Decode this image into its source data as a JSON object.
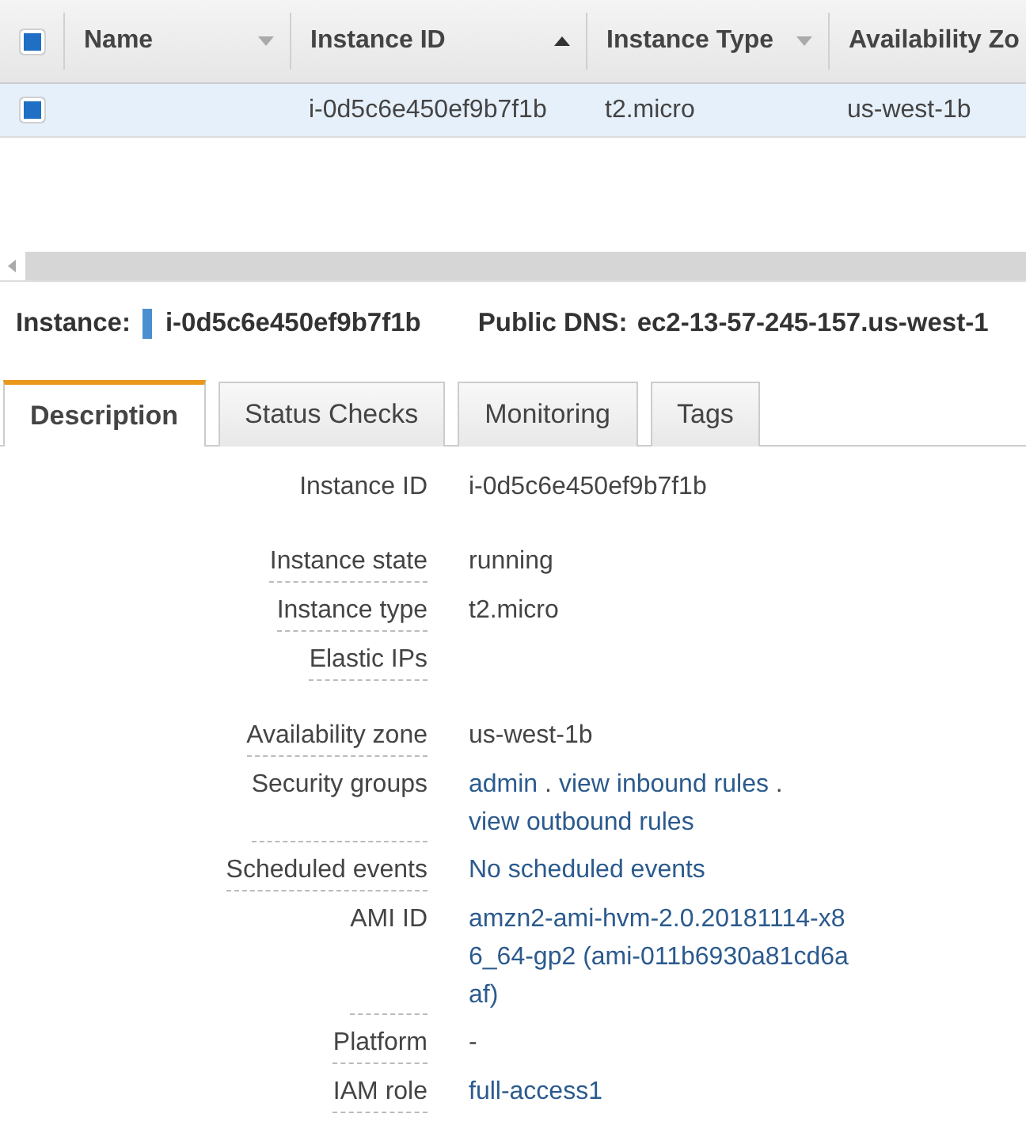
{
  "table": {
    "select_all": {
      "checked": true
    },
    "columns": [
      {
        "label": "Name",
        "sorted": false
      },
      {
        "label": "Instance ID",
        "sorted": true
      },
      {
        "label": "Instance Type",
        "sorted": false
      },
      {
        "label": "Availability Zo"
      }
    ],
    "rows": [
      {
        "selected": true,
        "checked": true,
        "cells": [
          "",
          "i-0d5c6e450ef9b7f1b",
          "t2.micro",
          "us-west-1b"
        ]
      }
    ]
  },
  "summary": {
    "instance_label": "Instance:",
    "instance_id": "i-0d5c6e450ef9b7f1b",
    "dns_label": "Public DNS:",
    "dns": "ec2-13-57-245-157.us-west-1"
  },
  "tabs": [
    {
      "label": "Description",
      "selected": true
    },
    {
      "label": "Status Checks",
      "selected": false
    },
    {
      "label": "Monitoring",
      "selected": false
    },
    {
      "label": "Tags",
      "selected": false
    }
  ],
  "sections": [
    [
      {
        "label": "Instance ID",
        "dashed": false,
        "parts": [
          {
            "kind": "text",
            "text": "i-0d5c6e450ef9b7f1b"
          }
        ]
      }
    ],
    [
      {
        "label": "Instance state",
        "dashed": true,
        "parts": [
          {
            "kind": "text",
            "text": "running"
          }
        ]
      },
      {
        "label": "Instance type",
        "dashed": true,
        "parts": [
          {
            "kind": "text",
            "text": "t2.micro"
          }
        ]
      },
      {
        "label": "Elastic IPs",
        "dashed": true
      }
    ],
    [
      {
        "label": "Availability zone",
        "dashed": true,
        "parts": [
          {
            "kind": "text",
            "text": "us-west-1b"
          }
        ]
      },
      {
        "label": "Security groups",
        "dashed": true,
        "parts": [
          {
            "kind": "link",
            "text": "admin"
          },
          {
            "kind": "sep",
            "text": "."
          },
          {
            "kind": "link",
            "text": "view inbound rules"
          },
          {
            "kind": "sep",
            "text": "."
          },
          {
            "kind": "link",
            "text": "view outbound rules"
          }
        ]
      },
      {
        "label": "Scheduled events",
        "dashed": true,
        "parts": [
          {
            "kind": "link",
            "text": "No scheduled events"
          }
        ]
      },
      {
        "label": "AMI ID",
        "dashed": true,
        "parts": [
          {
            "kind": "link",
            "text": "amzn2-ami-hvm-2.0.20181114-x86_64-gp2 (ami-011b6930a81cd6aaf)"
          }
        ]
      },
      {
        "label": "Platform",
        "dashed": true,
        "parts": [
          {
            "kind": "text",
            "text": "-"
          }
        ]
      },
      {
        "label": "IAM role",
        "dashed": true,
        "parts": [
          {
            "kind": "link",
            "text": "full-access1"
          }
        ]
      }
    ]
  ]
}
